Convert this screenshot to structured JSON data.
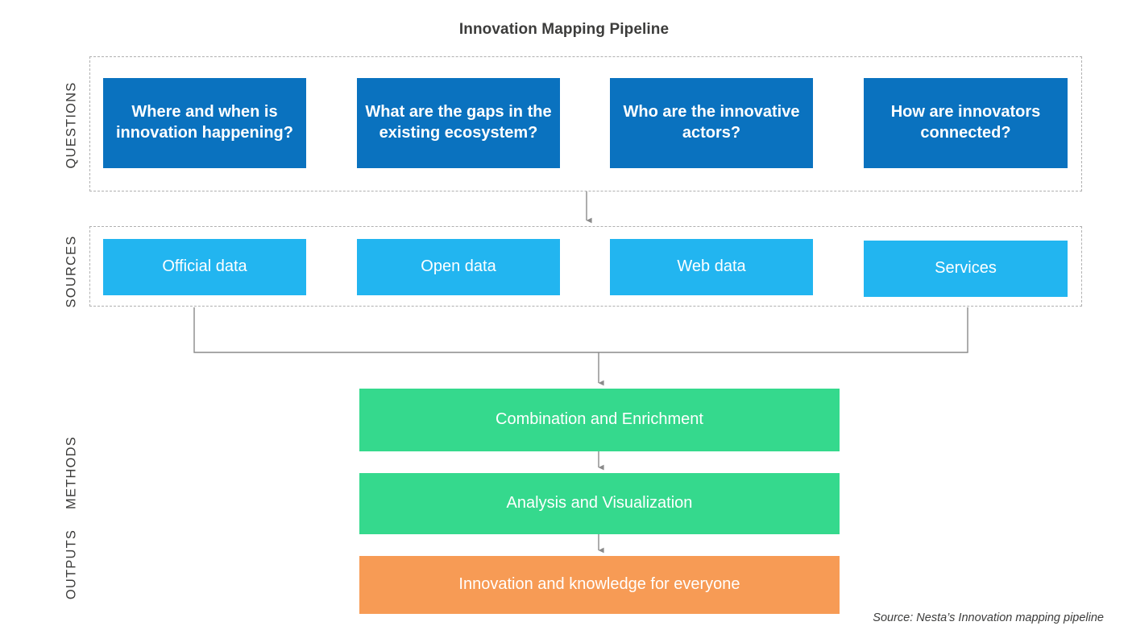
{
  "title": "Innovation Mapping Pipeline",
  "source_note": "Source: Nesta’s Innovation mapping pipeline",
  "colors": {
    "question_blue": "#0a72bf",
    "source_blue": "#22b5f0",
    "method_green": "#35d98d",
    "output_orange": "#f79b55",
    "dashed_border": "#b0b0b0",
    "connector_line": "#808080",
    "text_dark": "#3c3c3b",
    "box_text": "#ffffff",
    "background": "#ffffff"
  },
  "stages": {
    "questions": {
      "label": "QUESTIONS",
      "boxes": [
        {
          "text": "Where and when is innovation happening?"
        },
        {
          "text": "What are the gaps in the existing ecosystem?"
        },
        {
          "text": "Who are the innovative actors?"
        },
        {
          "text": "How are innovators connected?"
        }
      ]
    },
    "sources": {
      "label": "SOURCES",
      "boxes": [
        {
          "text": "Official data"
        },
        {
          "text": "Open data"
        },
        {
          "text": "Web data"
        },
        {
          "text": "Services"
        }
      ]
    },
    "methods": {
      "label": "METHODS",
      "boxes": [
        {
          "text": "Combination and Enrichment"
        },
        {
          "text": "Analysis and Visualization"
        }
      ]
    },
    "outputs": {
      "label": "OUTPUTS",
      "boxes": [
        {
          "text": "Innovation and knowledge for everyone"
        }
      ]
    }
  },
  "chart_data": {
    "type": "diagram",
    "title": "Innovation Mapping Pipeline",
    "flow_direction": "top-to-bottom",
    "layers": [
      {
        "name": "QUESTIONS",
        "color": "#0a72bf",
        "nodes": [
          "Where and when is innovation happening?",
          "What are the gaps in the existing ecosystem?",
          "Who are the innovative actors?",
          "How are innovators connected?"
        ]
      },
      {
        "name": "SOURCES",
        "color": "#22b5f0",
        "nodes": [
          "Official data",
          "Open data",
          "Web data",
          "Services"
        ]
      },
      {
        "name": "METHODS",
        "color": "#35d98d",
        "nodes": [
          "Combination and Enrichment",
          "Analysis and Visualization"
        ]
      },
      {
        "name": "OUTPUTS",
        "color": "#f79b55",
        "nodes": [
          "Innovation and knowledge for everyone"
        ]
      }
    ],
    "edges": [
      {
        "from": "QUESTIONS",
        "to": "SOURCES",
        "style": "arrow-down"
      },
      {
        "from": "SOURCES",
        "to": "Combination and Enrichment",
        "style": "bracket-merge-arrow-down"
      },
      {
        "from": "Combination and Enrichment",
        "to": "Analysis and Visualization",
        "style": "arrow-down"
      },
      {
        "from": "Analysis and Visualization",
        "to": "Innovation and knowledge for everyone",
        "style": "arrow-down"
      }
    ],
    "annotations": [
      "Source: Nesta’s Innovation mapping pipeline"
    ]
  }
}
